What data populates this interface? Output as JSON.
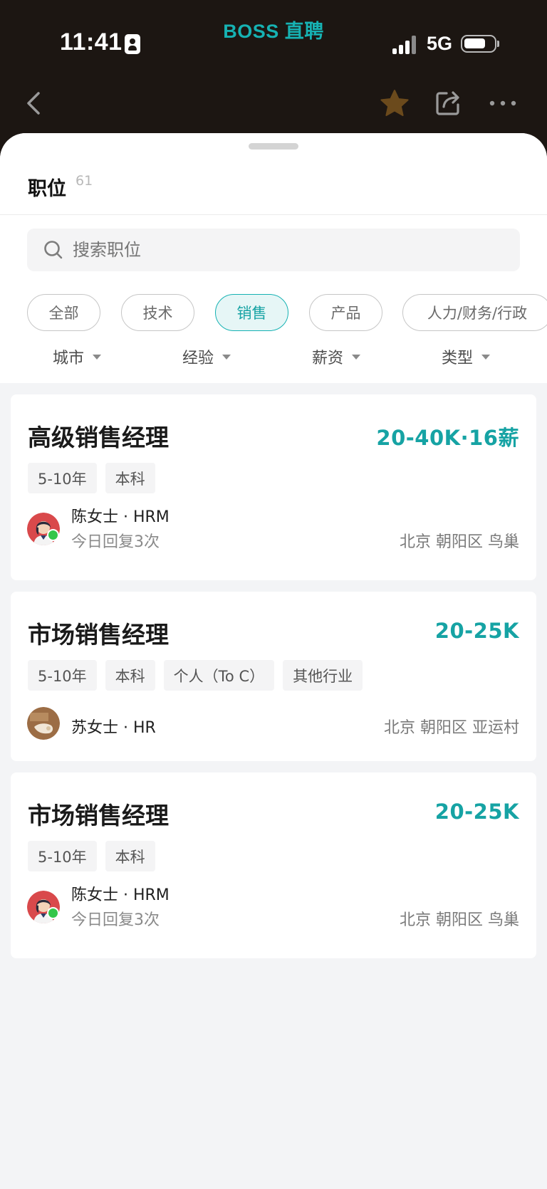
{
  "status_bar": {
    "time": "11:41",
    "network": "5G"
  },
  "app": {
    "brand": "BOSS 直聘"
  },
  "sheet": {
    "title": "职位",
    "count": "61",
    "search_placeholder": "搜索职位",
    "categories": [
      {
        "label": "全部",
        "active": false
      },
      {
        "label": "技术",
        "active": false
      },
      {
        "label": "销售",
        "active": true
      },
      {
        "label": "产品",
        "active": false
      },
      {
        "label": "人力/财务/行政",
        "active": false
      }
    ],
    "filters": [
      "城市",
      "经验",
      "薪资",
      "类型"
    ]
  },
  "jobs": [
    {
      "title": "高级销售经理",
      "salary": "20-40K·16薪",
      "tags": [
        "5-10年",
        "本科"
      ],
      "recruiter": "陈女士 · HRM",
      "reply": "今日回复3次",
      "location": "北京  朝阳区  鸟巢",
      "online": true
    },
    {
      "title": "市场销售经理",
      "salary": "20-25K",
      "tags": [
        "5-10年",
        "本科",
        "个人（To C）",
        "其他行业"
      ],
      "recruiter": "苏女士 · HR",
      "reply": "",
      "location": "北京  朝阳区  亚运村",
      "online": false
    },
    {
      "title": "市场销售经理",
      "salary": "20-25K",
      "tags": [
        "5-10年",
        "本科"
      ],
      "recruiter": "陈女士 · HRM",
      "reply": "今日回复3次",
      "location": "北京  朝阳区  鸟巢",
      "online": true
    }
  ],
  "colors": {
    "accent": "#16b2b3",
    "star": "#6b4a1c",
    "online": "#35c64a"
  },
  "icons": [
    "back-icon",
    "star-icon",
    "share-icon",
    "more-icon",
    "search-icon"
  ]
}
